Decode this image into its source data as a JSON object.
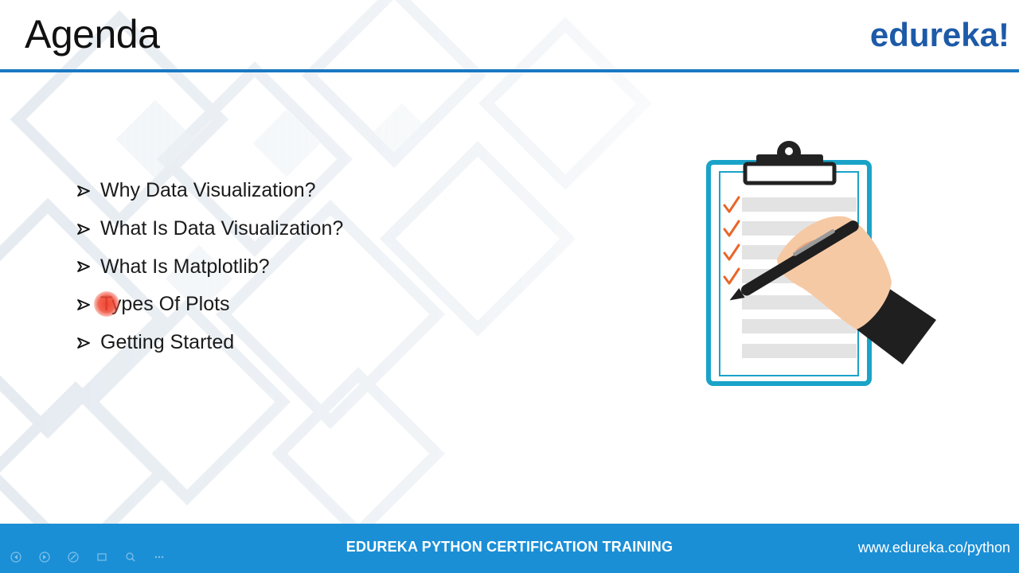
{
  "header": {
    "title": "Agenda",
    "brand": "edureka!"
  },
  "agenda": {
    "items": [
      {
        "label": "Why Data Visualization?"
      },
      {
        "label": "What Is Data Visualization?"
      },
      {
        "label": "What Is Matplotlib?"
      },
      {
        "label": "Types Of Plots"
      },
      {
        "label": "Getting Started"
      }
    ]
  },
  "footer": {
    "title": "EDUREKA PYTHON CERTIFICATION TRAINING",
    "url": "www.edureka.co/python"
  },
  "colors": {
    "accent_blue": "#1a78c2",
    "footer_blue": "#1b8fd6",
    "brand_blue": "#1d5aa8",
    "clipboard_teal": "#1aa3c9",
    "check_orange": "#e8662a",
    "pointer_red": "#f03c28"
  },
  "icons": {
    "bullet": "arrow-bullet-icon",
    "illustration": "clipboard-checklist-icon",
    "controls": [
      "previous-icon",
      "next-icon",
      "pen-icon",
      "slides-icon",
      "zoom-icon",
      "more-icon"
    ]
  }
}
